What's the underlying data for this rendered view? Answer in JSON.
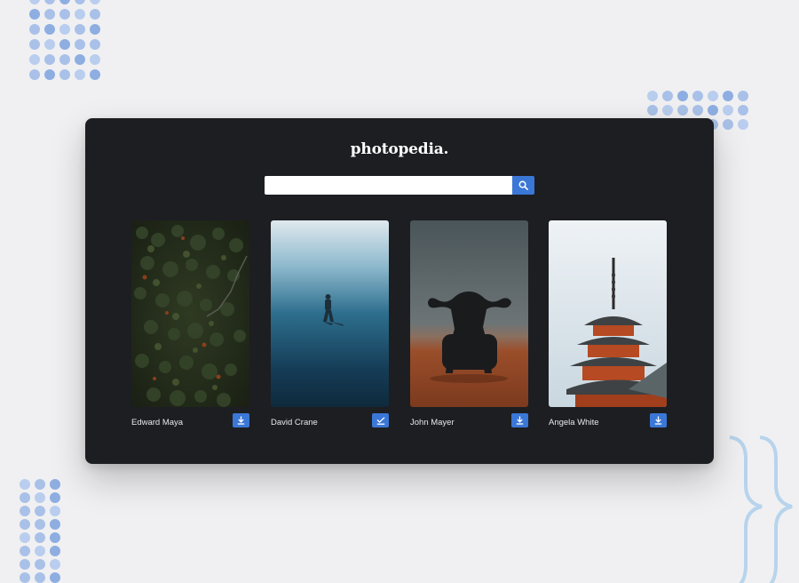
{
  "app": {
    "logo": "photopedia."
  },
  "search": {
    "value": "",
    "placeholder": "",
    "button_icon": "search-icon"
  },
  "photos": [
    {
      "author": "Edward Maya",
      "subject": "forest",
      "action_icon": "download-icon"
    },
    {
      "author": "David Crane",
      "subject": "diver",
      "action_icon": "downloaded-check-icon"
    },
    {
      "author": "John Mayer",
      "subject": "buffalo",
      "action_icon": "download-icon"
    },
    {
      "author": "Angela White",
      "subject": "pagoda",
      "action_icon": "download-icon"
    }
  ],
  "colors": {
    "background": "#f0f0f2",
    "panel": "#1c1e22",
    "accent": "#3b77d6",
    "decoration": "#a9c1e8"
  }
}
